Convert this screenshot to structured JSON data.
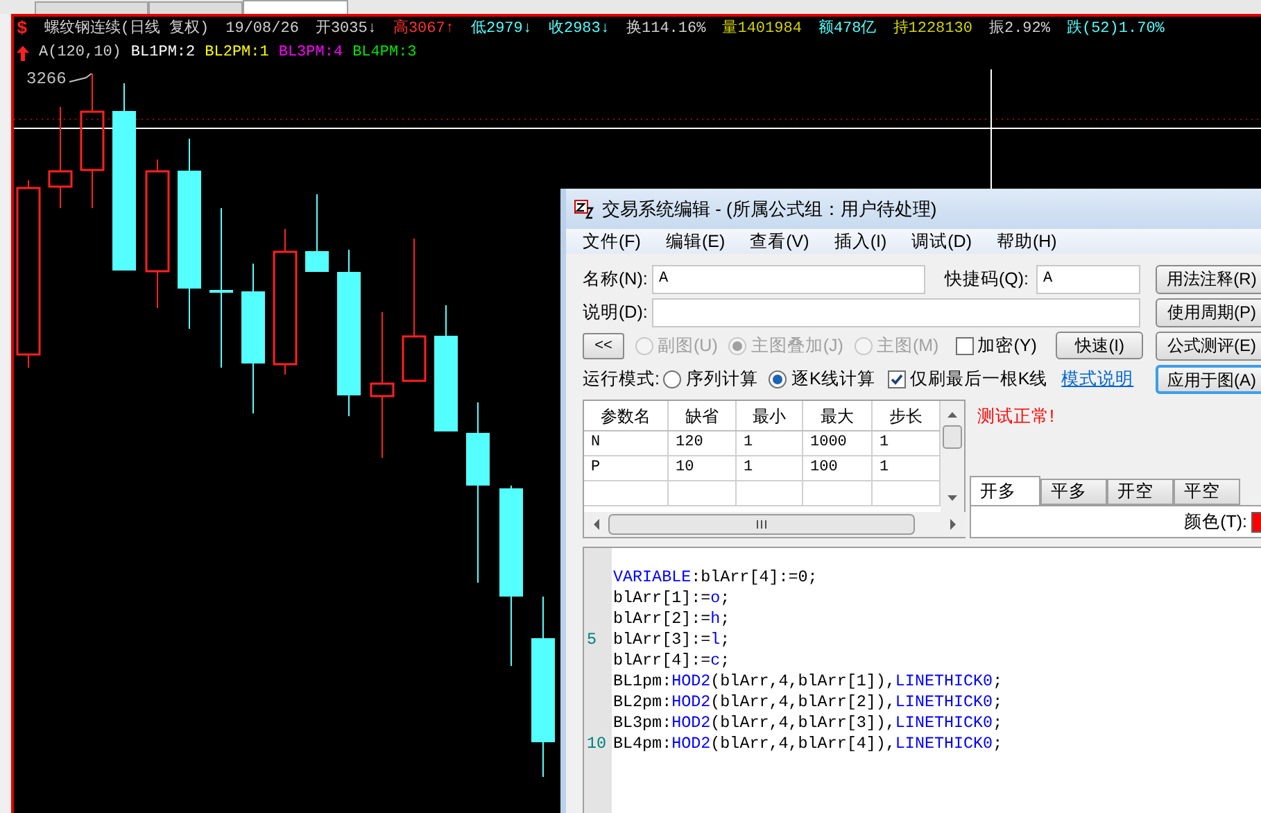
{
  "top_tabs": [
    {
      "selected": false
    },
    {
      "selected": false
    },
    {
      "selected": true
    }
  ],
  "quote_header": {
    "symbol_mark": "$",
    "line_1": [
      {
        "text": "螺纹钢连续(日线 复权)",
        "color": "#d0d0d0"
      },
      {
        "text": "19/08/26",
        "color": "#d0d0d0"
      },
      {
        "text": "开3035↓",
        "color": "#d0d0d0"
      },
      {
        "text": "高3067↑",
        "color": "#ff3232"
      },
      {
        "text": "低2979↓",
        "color": "#54ffff"
      },
      {
        "text": "收2983↓",
        "color": "#54ffff"
      },
      {
        "text": "换114.16%",
        "color": "#d0d0d0"
      },
      {
        "text": "量1401984",
        "color": "#d4d400"
      },
      {
        "text": "额478亿",
        "color": "#54ffff"
      },
      {
        "text": "持1228130",
        "color": "#d4d400"
      },
      {
        "text": "振2.92%",
        "color": "#d0d0d0"
      },
      {
        "text": "跌(52)1.70%",
        "color": "#54ffff"
      }
    ],
    "line_2": [
      {
        "text": "A(120,10)",
        "color": "#d0d0d0"
      },
      {
        "text": "BL1PM:2",
        "color": "#ffffff"
      },
      {
        "text": "BL2PM:1",
        "color": "#ffff00"
      },
      {
        "text": "BL3PM:4",
        "color": "#ff00ff"
      },
      {
        "text": "BL4PM:3",
        "color": "#00e600"
      }
    ]
  },
  "chart": {
    "high_label": "3266"
  },
  "dialog": {
    "title": "交易系统编辑 - (所属公式组：用户待处理)",
    "menu": [
      "文件(F)",
      "编辑(E)",
      "查看(V)",
      "插入(I)",
      "调试(D)",
      "帮助(H)"
    ],
    "name_label": "名称(N):",
    "name_value": "A",
    "shortcut_label": "快捷码(Q):",
    "shortcut_value": "A",
    "description_label": "说明(D):",
    "side_buttons": [
      {
        "label": "用法注释(R)",
        "selected": false
      },
      {
        "label": "使用周期(P)",
        "selected": false
      },
      {
        "label": "公式测评(E)",
        "selected": false
      },
      {
        "label": "应用于图(A)",
        "selected": true
      }
    ],
    "collapse_button": "<<",
    "chart_types": [
      {
        "label": "副图(U)",
        "selected": false,
        "disabled": true
      },
      {
        "label": "主图叠加(J)",
        "selected": true,
        "disabled": true
      },
      {
        "label": "主图(M)",
        "selected": false,
        "disabled": true
      }
    ],
    "encrypt": {
      "label": "加密(Y)",
      "checked": false
    },
    "quick_button": "快速(I)",
    "run_mode_label": "运行模式:",
    "run_modes": [
      {
        "label": "序列计算",
        "selected": false
      },
      {
        "label": "逐K线计算",
        "selected": true
      }
    ],
    "refresh_last_bar": {
      "label": "仅刷最后一根K线",
      "checked": true
    },
    "mode_help_link": "模式说明",
    "params": {
      "columns": [
        "参数名",
        "缺省",
        "最小",
        "最大",
        "步长"
      ],
      "rows": [
        [
          "N",
          "120",
          "1",
          "1000",
          "1"
        ],
        [
          "P",
          "10",
          "1",
          "100",
          "1"
        ]
      ]
    },
    "test_status": "测试正常!",
    "signal_tabs": [
      {
        "label": "开多",
        "selected": true
      },
      {
        "label": "平多",
        "selected": false
      },
      {
        "label": "开空",
        "selected": false
      },
      {
        "label": "平空",
        "selected": false
      }
    ],
    "color_label": "颜色(T):",
    "color_swatch": {
      "color": "#ff0000"
    },
    "code": [
      {
        "tokens": [
          {
            "text": "VARIABLE",
            "kind": "keyword"
          },
          {
            "text": ":blArr[4]:=0;",
            "kind": "plain"
          }
        ]
      },
      {
        "tokens": [
          {
            "text": "blArr[1]:=",
            "kind": "plain"
          },
          {
            "text": "o",
            "kind": "keyword"
          },
          {
            "text": ";",
            "kind": "plain"
          }
        ]
      },
      {
        "tokens": [
          {
            "text": "blArr[2]:=",
            "kind": "plain"
          },
          {
            "text": "h",
            "kind": "keyword"
          },
          {
            "text": ";",
            "kind": "plain"
          }
        ]
      },
      {
        "line_number": "5",
        "tokens": [
          {
            "text": "blArr[3]:=",
            "kind": "plain"
          },
          {
            "text": "l",
            "kind": "keyword"
          },
          {
            "text": ";",
            "kind": "plain"
          }
        ]
      },
      {
        "tokens": [
          {
            "text": "blArr[4]:=",
            "kind": "plain"
          },
          {
            "text": "c",
            "kind": "keyword"
          },
          {
            "text": ";",
            "kind": "plain"
          }
        ]
      },
      {
        "tokens": [
          {
            "text": "BL1pm:",
            "kind": "plain"
          },
          {
            "text": "HOD2",
            "kind": "keyword"
          },
          {
            "text": "(blArr,4,blArr[1]),",
            "kind": "plain"
          },
          {
            "text": "LINETHICK0",
            "kind": "keyword"
          },
          {
            "text": ";",
            "kind": "plain"
          }
        ]
      },
      {
        "tokens": [
          {
            "text": "BL2pm:",
            "kind": "plain"
          },
          {
            "text": "HOD2",
            "kind": "keyword"
          },
          {
            "text": "(blArr,4,blArr[2]),",
            "kind": "plain"
          },
          {
            "text": "LINETHICK0",
            "kind": "keyword"
          },
          {
            "text": ";",
            "kind": "plain"
          }
        ]
      },
      {
        "tokens": [
          {
            "text": "BL3pm:",
            "kind": "plain"
          },
          {
            "text": "HOD2",
            "kind": "keyword"
          },
          {
            "text": "(blArr,4,blArr[3]),",
            "kind": "plain"
          },
          {
            "text": "LINETHICK0",
            "kind": "keyword"
          },
          {
            "text": ";",
            "kind": "plain"
          }
        ]
      },
      {
        "line_number": "10",
        "tokens": [
          {
            "text": "BL4pm:",
            "kind": "plain"
          },
          {
            "text": "HOD2",
            "kind": "keyword"
          },
          {
            "text": "(blArr,4,blArr[4]),",
            "kind": "plain"
          },
          {
            "text": "LINETHICK0",
            "kind": "keyword"
          },
          {
            "text": ";",
            "kind": "plain"
          }
        ]
      }
    ]
  }
}
